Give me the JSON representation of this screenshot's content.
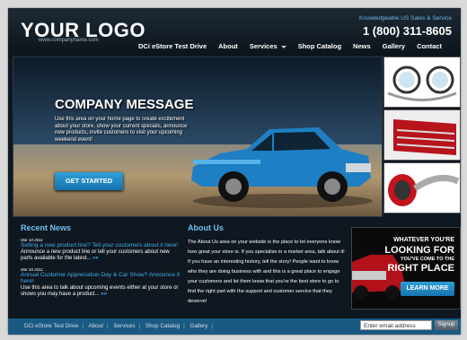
{
  "header": {
    "logo": "YOUR LOGO",
    "logo_url": "www.companyname.com",
    "tagline": "Knowledgeable US Sales & Service",
    "phone": "1 (800) 311-8605"
  },
  "nav": {
    "items": [
      "DCi eStore Test Drive",
      "About",
      "Services",
      "Shop Catalog",
      "News",
      "Gallery",
      "Contact"
    ]
  },
  "hero": {
    "title": "COMPANY MESSAGE",
    "text": "Use this area on your home page to create excitement about your store, show your current specials, announce new products, invite customers to visit your upcoming weekend event!",
    "button": "GET STARTED"
  },
  "news": {
    "title": "Recent News",
    "items": [
      {
        "date": "Mar 10 2011",
        "headline": "Selling a new product line? Tell your customers about it here!",
        "text": "Announce a new product line or tell your customers about new parts available for the latest...",
        "more": "»»"
      },
      {
        "date": "Mar 03 2011",
        "headline": "Annual Customer Appreciation Day & Car Show? Announce it here!",
        "text": "Use this area to talk about upcoming events either at your store or shows you may have a product...",
        "more": "»»"
      }
    ]
  },
  "about": {
    "title": "About Us",
    "text": "The About Us area on your website is the place to let everyone know how great your store is. If you specialize in a market area, talk about it! If you have an interesting history, tell the story! People want to know who they are doing business with and this is a great place to engage your customers and let them know that you're the best store to go to find the right part with the support and customer service that they deserve!"
  },
  "promo": {
    "line1": "WHATEVER YOU'RE",
    "line2": "LOOKING FOR",
    "line3": "YOU'VE COME TO THE",
    "line4": "RIGHT PLACE",
    "button": "LEARN MORE"
  },
  "footer": {
    "links": [
      "DCi eStore Test Drive",
      "About",
      "Services",
      "Shop Catalog",
      "Gallery"
    ],
    "email_placeholder": "Enter email address",
    "signup": "Signup"
  },
  "colors": {
    "accent": "#42aee8",
    "footer_bg": "#1a5a82",
    "page_bg": "#0f1720"
  }
}
